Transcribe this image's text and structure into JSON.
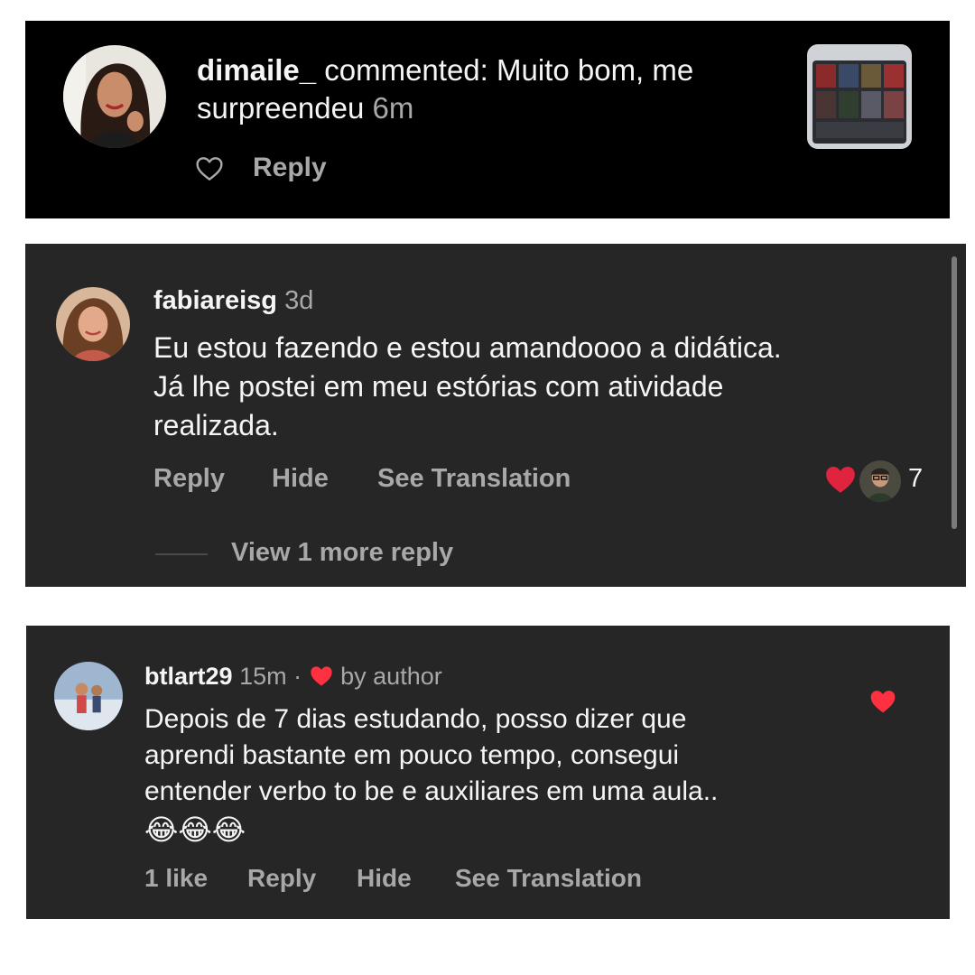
{
  "card1": {
    "username": "dimaile_",
    "action_text": " commented: Muito bom, me",
    "comment_line2": "surpreendeu",
    "time": "6m",
    "reply_label": "Reply",
    "icons": {
      "like": "heart-outline-icon"
    }
  },
  "card2": {
    "username": "fabiareisg",
    "time": "3d",
    "comment_lines": [
      "Eu estou fazendo e estou amandoooo a didática.",
      "Já lhe postei em meu estórias com atividade",
      "realizada."
    ],
    "actions": {
      "reply": "Reply",
      "hide": "Hide",
      "translate": "See Translation"
    },
    "like_count": "7",
    "view_more": "View 1 more reply",
    "colors": {
      "like_heart": "#e0243f"
    }
  },
  "card3": {
    "username": "btlart29",
    "time": "15m",
    "separator": "·",
    "author_badge": "by author",
    "comment_lines": [
      "Depois de 7 dias estudando, posso dizer que",
      "aprendi bastante em pouco tempo, consegui",
      "entender verbo to be e auxiliares em uma aula.."
    ],
    "emojis": "😂😂😂",
    "actions": {
      "likes": "1 like",
      "reply": "Reply",
      "hide": "Hide",
      "translate": "See Translation"
    },
    "colors": {
      "like_heart": "#ff3040"
    }
  }
}
